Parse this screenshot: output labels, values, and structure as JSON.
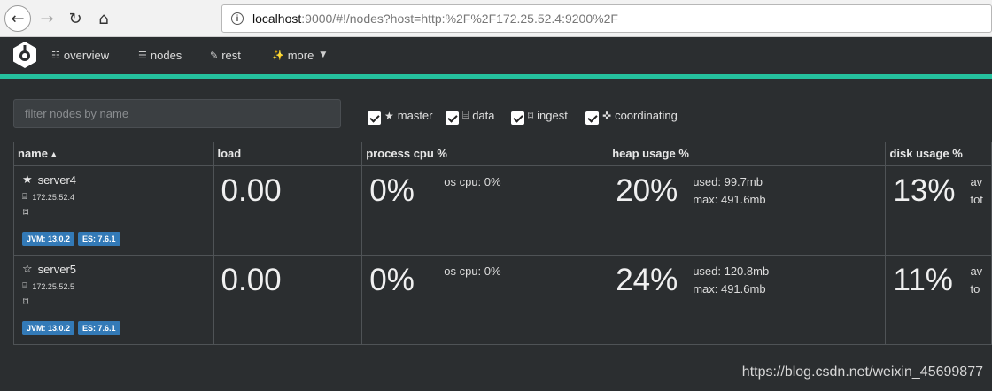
{
  "browser": {
    "url_host": "localhost",
    "url_rest": ":9000/#!/nodes?host=http:%2F%2F172.25.52.4:9200%2F"
  },
  "nav": {
    "items": [
      {
        "label": "overview",
        "icon": "sitemap-icon"
      },
      {
        "label": "nodes",
        "icon": "server-icon"
      },
      {
        "label": "rest",
        "icon": "edit-icon"
      },
      {
        "label": "more",
        "icon": "magic-icon"
      }
    ]
  },
  "filter": {
    "placeholder": "filter nodes by name"
  },
  "roles": [
    {
      "label": "master",
      "checked": true,
      "icon": "star-icon"
    },
    {
      "label": "data",
      "checked": true,
      "icon": "hdd-icon"
    },
    {
      "label": "ingest",
      "checked": true,
      "icon": "crop-icon"
    },
    {
      "label": "coordinating",
      "checked": true,
      "icon": "arrows-icon"
    }
  ],
  "columns": [
    "name",
    "load",
    "process cpu %",
    "heap usage %",
    "disk usage %"
  ],
  "nodes": [
    {
      "name": "server4",
      "ip": "172.25.52.4",
      "master_icon": "star-filled-icon",
      "jvm": "JVM: 13.0.2",
      "es": "ES: 7.6.1",
      "load": "0.00",
      "cpu": "0%",
      "os_cpu": "os cpu: 0%",
      "heap": "20%",
      "heap_used": "used: 99.7mb",
      "heap_max": "max: 491.6mb",
      "disk": "13%",
      "disk_avail": "av",
      "disk_total": "tot"
    },
    {
      "name": "server5",
      "ip": "172.25.52.5",
      "master_icon": "star-empty-icon",
      "jvm": "JVM: 13.0.2",
      "es": "ES: 7.6.1",
      "load": "0.00",
      "cpu": "0%",
      "os_cpu": "os cpu: 0%",
      "heap": "24%",
      "heap_used": "used: 120.8mb",
      "heap_max": "max: 491.6mb",
      "disk": "11%",
      "disk_avail": "av",
      "disk_total": "to"
    }
  ],
  "watermark": "https://blog.csdn.net/weixin_45699877",
  "colors": {
    "accent": "#25c19e",
    "badge": "#337ab7",
    "background": "#2b2e30"
  }
}
